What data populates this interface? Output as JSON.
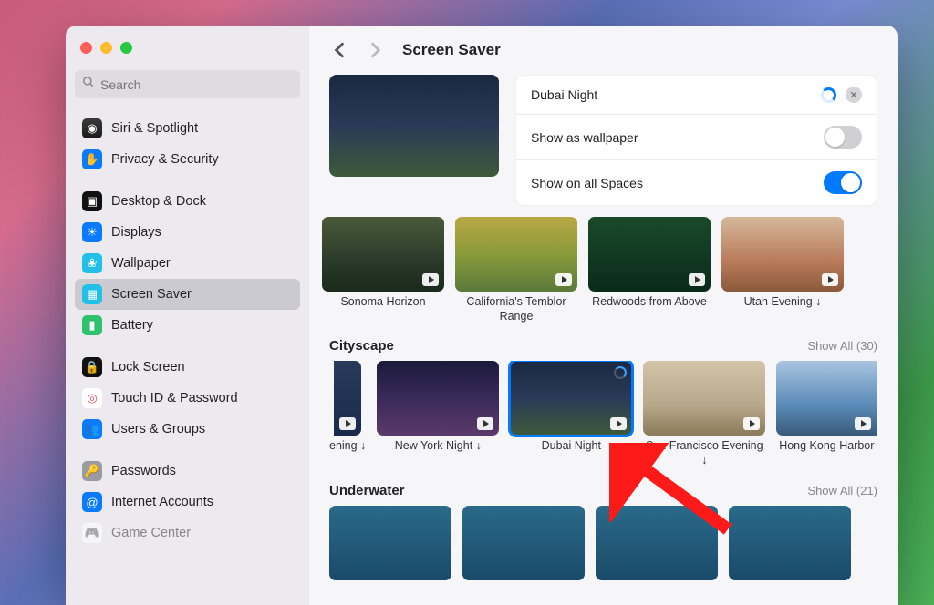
{
  "window": {
    "title": "Screen Saver"
  },
  "sidebar": {
    "search_placeholder": "Search",
    "groups": [
      [
        {
          "label": "Siri & Spotlight",
          "icon_bg": "linear-gradient(#3a3a3a,#1a1a1a)",
          "icon_name": "siri-icon",
          "glyph": "◉"
        },
        {
          "label": "Privacy & Security",
          "icon_bg": "#0a7aff",
          "icon_name": "hand-icon",
          "glyph": "✋"
        }
      ],
      [
        {
          "label": "Desktop & Dock",
          "icon_bg": "#111",
          "icon_name": "dock-icon",
          "glyph": "▣"
        },
        {
          "label": "Displays",
          "icon_bg": "#0a7aff",
          "icon_name": "displays-icon",
          "glyph": "☀"
        },
        {
          "label": "Wallpaper",
          "icon_bg": "#22c0e8",
          "icon_name": "wallpaper-icon",
          "glyph": "❀"
        },
        {
          "label": "Screen Saver",
          "icon_bg": "#22c0e8",
          "icon_name": "screen-saver-icon",
          "glyph": "▦",
          "selected": true
        },
        {
          "label": "Battery",
          "icon_bg": "#2dc26b",
          "icon_name": "battery-icon",
          "glyph": "▮"
        }
      ],
      [
        {
          "label": "Lock Screen",
          "icon_bg": "#111",
          "icon_name": "lock-icon",
          "glyph": "🔒"
        },
        {
          "label": "Touch ID & Password",
          "icon_bg": "#fff",
          "icon_color": "#e64a5a",
          "icon_name": "touchid-icon",
          "glyph": "◎"
        },
        {
          "label": "Users & Groups",
          "icon_bg": "#0a7aff",
          "icon_name": "users-icon",
          "glyph": "👥"
        }
      ],
      [
        {
          "label": "Passwords",
          "icon_bg": "#9a9aa0",
          "icon_name": "passwords-icon",
          "glyph": "🔑"
        },
        {
          "label": "Internet Accounts",
          "icon_bg": "#0a7aff",
          "icon_name": "internet-accounts-icon",
          "glyph": "@"
        },
        {
          "label": "Game Center",
          "icon_bg": "#fff",
          "icon_name": "game-center-icon",
          "glyph": "🎮",
          "cut": true
        }
      ]
    ]
  },
  "options": {
    "current_name": "Dubai Night",
    "row1_label": "Show as wallpaper",
    "row1_on": false,
    "row2_label": "Show on all Spaces",
    "row2_on": true
  },
  "sections": {
    "top_items": [
      {
        "label": "Sonoma Horizon",
        "theme": "t-sonoma"
      },
      {
        "label": "California's Temblor Range",
        "theme": "t-cal"
      },
      {
        "label": "Redwoods from Above",
        "theme": "t-red"
      },
      {
        "label": "Utah Evening ↓",
        "theme": "t-utah"
      }
    ],
    "cityscape_title": "Cityscape",
    "cityscape_show_all": "Show All (30)",
    "cityscape_items": [
      {
        "label": "ening ↓",
        "theme": "t-dark",
        "partial_left": true
      },
      {
        "label": "New York Night ↓",
        "theme": "t-ny"
      },
      {
        "label": "Dubai Night",
        "theme": "t-dubai",
        "selected": true,
        "downloading": true
      },
      {
        "label": "San Francisco Evening ↓",
        "theme": "t-sf"
      },
      {
        "label": "Hong Kong Harbor",
        "theme": "t-hk",
        "partial_right": true
      }
    ],
    "underwater_title": "Underwater",
    "underwater_show_all": "Show All (21)"
  }
}
